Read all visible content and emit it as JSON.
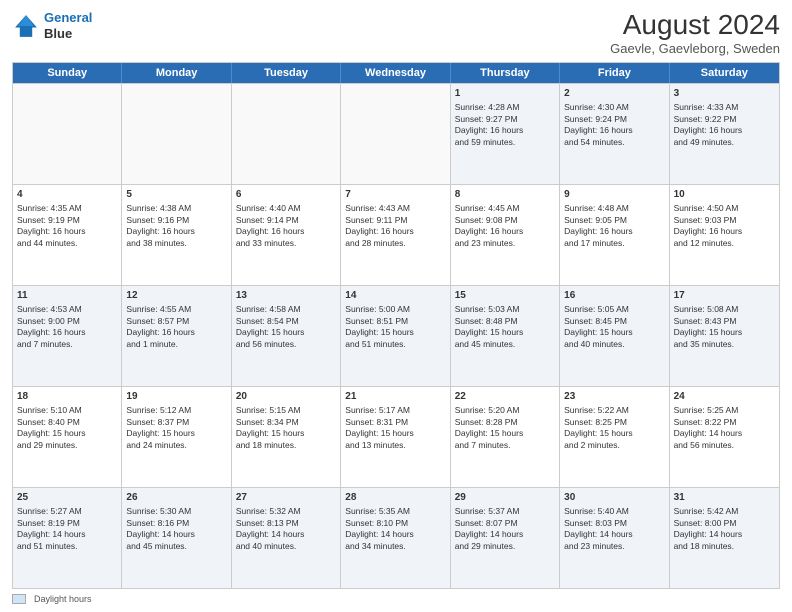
{
  "header": {
    "logo_line1": "General",
    "logo_line2": "Blue",
    "main_title": "August 2024",
    "subtitle": "Gaevle, Gaevleborg, Sweden"
  },
  "weekdays": [
    "Sunday",
    "Monday",
    "Tuesday",
    "Wednesday",
    "Thursday",
    "Friday",
    "Saturday"
  ],
  "weeks": [
    [
      {
        "day": "",
        "info": ""
      },
      {
        "day": "",
        "info": ""
      },
      {
        "day": "",
        "info": ""
      },
      {
        "day": "",
        "info": ""
      },
      {
        "day": "1",
        "info": "Sunrise: 4:28 AM\nSunset: 9:27 PM\nDaylight: 16 hours\nand 59 minutes."
      },
      {
        "day": "2",
        "info": "Sunrise: 4:30 AM\nSunset: 9:24 PM\nDaylight: 16 hours\nand 54 minutes."
      },
      {
        "day": "3",
        "info": "Sunrise: 4:33 AM\nSunset: 9:22 PM\nDaylight: 16 hours\nand 49 minutes."
      }
    ],
    [
      {
        "day": "4",
        "info": "Sunrise: 4:35 AM\nSunset: 9:19 PM\nDaylight: 16 hours\nand 44 minutes."
      },
      {
        "day": "5",
        "info": "Sunrise: 4:38 AM\nSunset: 9:16 PM\nDaylight: 16 hours\nand 38 minutes."
      },
      {
        "day": "6",
        "info": "Sunrise: 4:40 AM\nSunset: 9:14 PM\nDaylight: 16 hours\nand 33 minutes."
      },
      {
        "day": "7",
        "info": "Sunrise: 4:43 AM\nSunset: 9:11 PM\nDaylight: 16 hours\nand 28 minutes."
      },
      {
        "day": "8",
        "info": "Sunrise: 4:45 AM\nSunset: 9:08 PM\nDaylight: 16 hours\nand 23 minutes."
      },
      {
        "day": "9",
        "info": "Sunrise: 4:48 AM\nSunset: 9:05 PM\nDaylight: 16 hours\nand 17 minutes."
      },
      {
        "day": "10",
        "info": "Sunrise: 4:50 AM\nSunset: 9:03 PM\nDaylight: 16 hours\nand 12 minutes."
      }
    ],
    [
      {
        "day": "11",
        "info": "Sunrise: 4:53 AM\nSunset: 9:00 PM\nDaylight: 16 hours\nand 7 minutes."
      },
      {
        "day": "12",
        "info": "Sunrise: 4:55 AM\nSunset: 8:57 PM\nDaylight: 16 hours\nand 1 minute."
      },
      {
        "day": "13",
        "info": "Sunrise: 4:58 AM\nSunset: 8:54 PM\nDaylight: 15 hours\nand 56 minutes."
      },
      {
        "day": "14",
        "info": "Sunrise: 5:00 AM\nSunset: 8:51 PM\nDaylight: 15 hours\nand 51 minutes."
      },
      {
        "day": "15",
        "info": "Sunrise: 5:03 AM\nSunset: 8:48 PM\nDaylight: 15 hours\nand 45 minutes."
      },
      {
        "day": "16",
        "info": "Sunrise: 5:05 AM\nSunset: 8:45 PM\nDaylight: 15 hours\nand 40 minutes."
      },
      {
        "day": "17",
        "info": "Sunrise: 5:08 AM\nSunset: 8:43 PM\nDaylight: 15 hours\nand 35 minutes."
      }
    ],
    [
      {
        "day": "18",
        "info": "Sunrise: 5:10 AM\nSunset: 8:40 PM\nDaylight: 15 hours\nand 29 minutes."
      },
      {
        "day": "19",
        "info": "Sunrise: 5:12 AM\nSunset: 8:37 PM\nDaylight: 15 hours\nand 24 minutes."
      },
      {
        "day": "20",
        "info": "Sunrise: 5:15 AM\nSunset: 8:34 PM\nDaylight: 15 hours\nand 18 minutes."
      },
      {
        "day": "21",
        "info": "Sunrise: 5:17 AM\nSunset: 8:31 PM\nDaylight: 15 hours\nand 13 minutes."
      },
      {
        "day": "22",
        "info": "Sunrise: 5:20 AM\nSunset: 8:28 PM\nDaylight: 15 hours\nand 7 minutes."
      },
      {
        "day": "23",
        "info": "Sunrise: 5:22 AM\nSunset: 8:25 PM\nDaylight: 15 hours\nand 2 minutes."
      },
      {
        "day": "24",
        "info": "Sunrise: 5:25 AM\nSunset: 8:22 PM\nDaylight: 14 hours\nand 56 minutes."
      }
    ],
    [
      {
        "day": "25",
        "info": "Sunrise: 5:27 AM\nSunset: 8:19 PM\nDaylight: 14 hours\nand 51 minutes."
      },
      {
        "day": "26",
        "info": "Sunrise: 5:30 AM\nSunset: 8:16 PM\nDaylight: 14 hours\nand 45 minutes."
      },
      {
        "day": "27",
        "info": "Sunrise: 5:32 AM\nSunset: 8:13 PM\nDaylight: 14 hours\nand 40 minutes."
      },
      {
        "day": "28",
        "info": "Sunrise: 5:35 AM\nSunset: 8:10 PM\nDaylight: 14 hours\nand 34 minutes."
      },
      {
        "day": "29",
        "info": "Sunrise: 5:37 AM\nSunset: 8:07 PM\nDaylight: 14 hours\nand 29 minutes."
      },
      {
        "day": "30",
        "info": "Sunrise: 5:40 AM\nSunset: 8:03 PM\nDaylight: 14 hours\nand 23 minutes."
      },
      {
        "day": "31",
        "info": "Sunrise: 5:42 AM\nSunset: 8:00 PM\nDaylight: 14 hours\nand 18 minutes."
      }
    ]
  ],
  "legend": {
    "box_label": "Daylight hours"
  }
}
